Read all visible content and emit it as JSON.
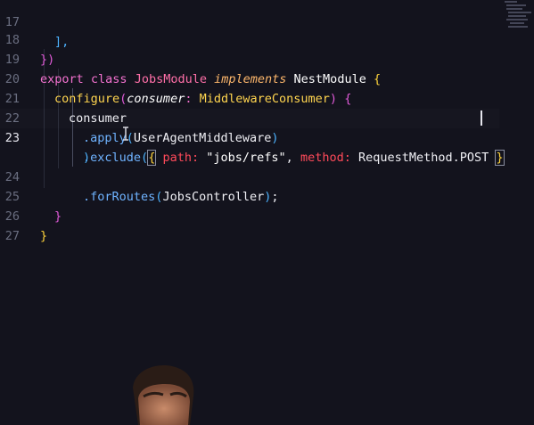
{
  "editor": {
    "line_numbers": [
      "17",
      "18",
      "19",
      "20",
      "21",
      "22",
      "23",
      "24",
      "25",
      "26",
      "27"
    ],
    "active_line": "23",
    "lines": {
      "l17": {
        "a": "],",
        "indent": "    "
      },
      "l18": {
        "a": "})"
      },
      "l19": {
        "export": "export",
        "class": "class",
        "name": "JobsModule",
        "implements": "implements",
        "iface": "NestModule",
        "brace": "{"
      },
      "l20": {
        "fn": "configure",
        "open": "(",
        "param": "consumer",
        "colon": ":",
        "type": "MiddlewareConsumer",
        "close": ")",
        "brace": "{"
      },
      "l21": {
        "text": "consumer"
      },
      "l22": {
        "dot": ".",
        "method": "apply",
        "open": "(",
        "arg": "UserAgentMiddleware",
        "close": ")"
      },
      "l23": {
        "dot": ".",
        "method": "exclude",
        "open": "(",
        "lbrace": "{",
        "key1": "path",
        "colon1": ":",
        "val1": "\"jobs/refs\"",
        "comma": ",",
        "key2": "method",
        "colon2": ":",
        "val2": "RequestMethod.POST",
        "rbrace": "}"
      },
      "l24a": {
        "close": ")"
      },
      "l24": {
        "dot": ".",
        "method": "forRoutes",
        "open": "(",
        "arg": "JobsController",
        "close": ")",
        "semi": ";"
      },
      "l25": {
        "brace": "}"
      },
      "l26": {
        "brace": "}"
      }
    }
  },
  "colors": {
    "background": "#13131d",
    "keyword": "#f472d0",
    "string_key": "#ff4a5a",
    "method": "#6fb3ff",
    "function": "#ffd54f",
    "bracket_1": "#ffd43b",
    "bracket_2": "#e05ad8",
    "bracket_3": "#4db3ff"
  },
  "icons": {
    "text_cursor": "ibeam-cursor-icon"
  }
}
